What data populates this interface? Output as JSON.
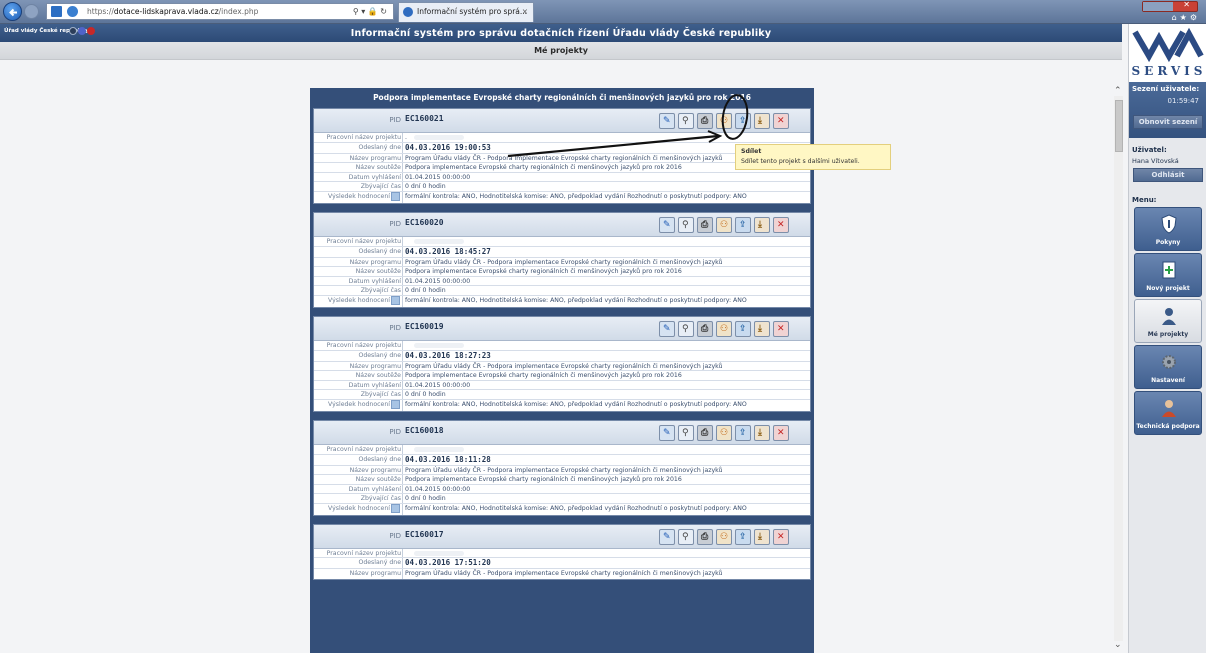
{
  "browser": {
    "url_prefix": "https://",
    "url_domain": "dotace-lidskaprava.vlada.cz",
    "url_path": "/index.php",
    "tab_title": "Informační systém pro sprá...",
    "tab_close": "×"
  },
  "header": {
    "org": "Úřad vlády České republiky",
    "title": "Informační systém pro správu dotačních řízení Úřadu vlády České republiky",
    "subtitle": "Mé projekty"
  },
  "sidebar": {
    "logo_text": "SERVIS",
    "session_label": "Sezení uživatele:",
    "session_time": "01:59:47",
    "renew_label": "Obnovit sezení",
    "user_label": "Uživatel:",
    "user_name": "Hana Vítovská",
    "logout_label": "Odhlásit",
    "menu_label": "Menu:",
    "menu": [
      {
        "label": "Pokyny",
        "icon": "shield-icon"
      },
      {
        "label": "Nový projekt",
        "icon": "new-document-icon"
      },
      {
        "label": "Mé projekty",
        "icon": "user-projects-icon"
      },
      {
        "label": "Nastavení",
        "icon": "gear-icon"
      },
      {
        "label": "Technická podpora",
        "icon": "support-person-icon"
      }
    ]
  },
  "main": {
    "title": "Podpora implementace Evropské charty regionálních či menšinových jazyků pro rok 2016",
    "labels": {
      "pid": "PID",
      "working_name": "Pracovní název projektu",
      "sent": "Odeslaný dne",
      "program": "Název programu",
      "call": "Název soutěže",
      "announced": "Datum vyhlášení",
      "remaining": "Zbývající čas",
      "result": "Výsledek hodnocení"
    },
    "projects": [
      {
        "pid": "EC160021",
        "working_name": ".",
        "sent": "04.03.2016 19:00:53",
        "program": "Program Úřadu vlády ČR - Podpora implementace Evropské charty regionálních či menšinových jazyků",
        "call": "Podpora implementace Evropské charty regionálních či menšinových jazyků pro rok 2016",
        "announced": "01.04.2015 00:00:00",
        "remaining": "0 dní 0 hodin",
        "result": "formální kontrola: ANO, Hodnotitelská komise: ANO, předpoklad vydání Rozhodnutí o poskytnutí podpory: ANO"
      },
      {
        "pid": "EC160020",
        "working_name": "",
        "sent": "04.03.2016 18:45:27",
        "program": "Program Úřadu vlády ČR - Podpora implementace Evropské charty regionálních či menšinových jazyků",
        "call": "Podpora implementace Evropské charty regionálních či menšinových jazyků pro rok 2016",
        "announced": "01.04.2015 00:00:00",
        "remaining": "0 dní 0 hodin",
        "result": "formální kontrola: ANO, Hodnotitelská komise: ANO, předpoklad vydání Rozhodnutí o poskytnutí podpory: ANO"
      },
      {
        "pid": "EC160019",
        "working_name": "",
        "sent": "04.03.2016 18:27:23",
        "program": "Program Úřadu vlády ČR - Podpora implementace Evropské charty regionálních či menšinových jazyků",
        "call": "Podpora implementace Evropské charty regionálních či menšinových jazyků pro rok 2016",
        "announced": "01.04.2015 00:00:00",
        "remaining": "0 dní 0 hodin",
        "result": "formální kontrola: ANO, Hodnotitelská komise: ANO, předpoklad vydání Rozhodnutí o poskytnutí podpory: ANO"
      },
      {
        "pid": "EC160018",
        "working_name": "",
        "sent": "04.03.2016 18:11:28",
        "program": "Program Úřadu vlády ČR - Podpora implementace Evropské charty regionálních či menšinových jazyků",
        "call": "Podpora implementace Evropské charty regionálních či menšinových jazyků pro rok 2016",
        "announced": "01.04.2015 00:00:00",
        "remaining": "0 dní 0 hodin",
        "result": "formální kontrola: ANO, Hodnotitelská komise: ANO, předpoklad vydání Rozhodnutí o poskytnutí podpory: ANO"
      },
      {
        "pid": "EC160017",
        "working_name": "",
        "sent": "04.03.2016 17:51:20",
        "program": "Program Úřadu vlády ČR - Podpora implementace Evropské charty regionálních či menšinových jazyků"
      }
    ]
  },
  "tooltip": {
    "title": "Sdílet",
    "text": "Sdílet tento projekt s dalšími uživateli."
  },
  "colors": {
    "header_blue": "#2c4a76",
    "panel_blue": "#344f79",
    "tooltip_yellow": "#fff7c4"
  }
}
